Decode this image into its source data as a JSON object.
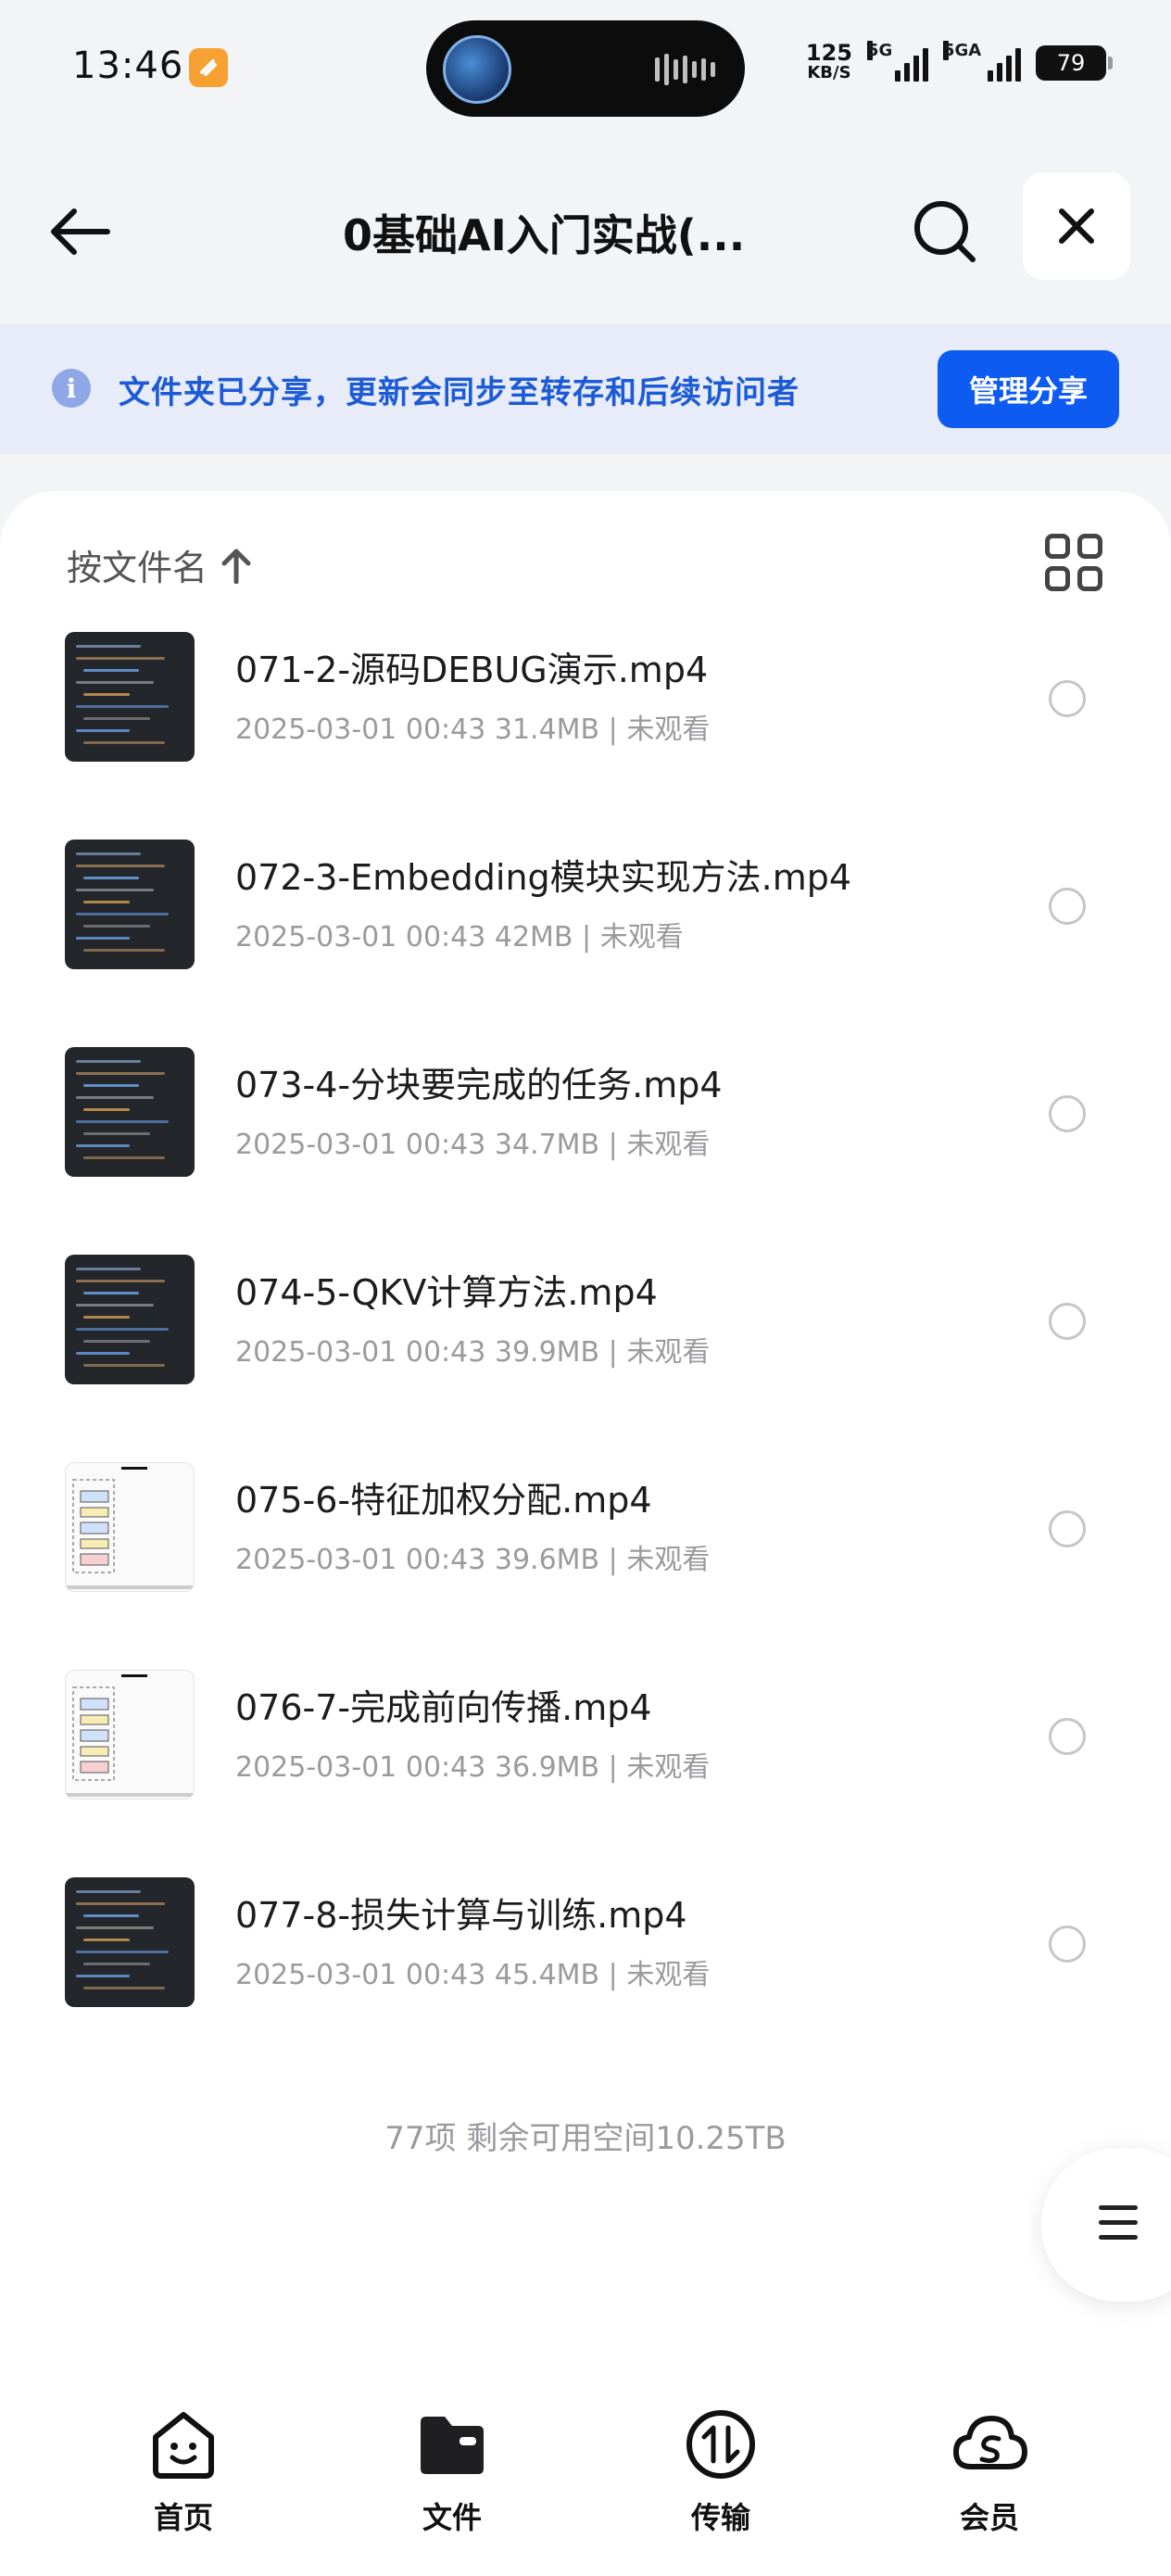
{
  "status_bar": {
    "time": "13:46",
    "speed_value": "125",
    "speed_unit": "KB/S",
    "network1": "5G",
    "network2": "5GA",
    "battery": "79"
  },
  "header": {
    "title": "0基础AI入门实战(..."
  },
  "banner": {
    "text": "文件夹已分享，更新会同步至转存和后续访问者",
    "button_label": "管理分享"
  },
  "list": {
    "sort_label": "按文件名",
    "files": [
      {
        "name": "071-2-源码DEBUG演示.mp4",
        "meta": "2025-03-01 00:43 31.4MB | 未观看",
        "thumb": "dark"
      },
      {
        "name": "072-3-Embedding模块实现方法.mp4",
        "meta": "2025-03-01 00:43 42MB | 未观看",
        "thumb": "dark"
      },
      {
        "name": "073-4-分块要完成的任务.mp4",
        "meta": "2025-03-01 00:43 34.7MB | 未观看",
        "thumb": "dark"
      },
      {
        "name": "074-5-QKV计算方法.mp4",
        "meta": "2025-03-01 00:43 39.9MB | 未观看",
        "thumb": "dark"
      },
      {
        "name": "075-6-特征加权分配.mp4",
        "meta": "2025-03-01 00:43 39.6MB | 未观看",
        "thumb": "light"
      },
      {
        "name": "076-7-完成前向传播.mp4",
        "meta": "2025-03-01 00:43 36.9MB | 未观看",
        "thumb": "light"
      },
      {
        "name": "077-8-损失计算与训练.mp4",
        "meta": "2025-03-01 00:43 45.4MB | 未观看",
        "thumb": "dark"
      }
    ],
    "footer": "77项 剩余可用空间10.25TB"
  },
  "bottom_nav": {
    "items": [
      {
        "label": "首页",
        "icon": "home-icon"
      },
      {
        "label": "文件",
        "icon": "folder-icon"
      },
      {
        "label": "传输",
        "icon": "transfer-icon"
      },
      {
        "label": "会员",
        "icon": "vip-cloud-icon"
      }
    ]
  },
  "colors": {
    "accent": "#0d5bf0",
    "banner_bg": "#e7ecf8",
    "banner_text": "#1d5bd6"
  }
}
